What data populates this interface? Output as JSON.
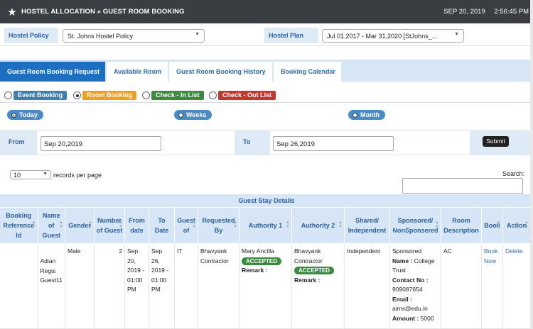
{
  "titlebar": {
    "title": "HOSTEL ALLOCATION » GUEST ROOM BOOKING",
    "date": "SEP 20, 2019",
    "time": "2:56:45 PM",
    "icon": "star-icon"
  },
  "policy": {
    "policy_label": "Hostel Policy",
    "policy_value": "St. Johns Hostel Policy",
    "plan_label": "Hostel Plan",
    "plan_value": "Jul 01,2017 - Mar 31,2020 [StJohns_..."
  },
  "tabs": [
    "Guest Room Booking Request",
    "Available Room",
    "Guest Room Booking History",
    "Booking Calendar"
  ],
  "booking_types": {
    "event": "Event Booking",
    "room": "Room Booking",
    "checkin": "Check - In List",
    "checkout": "Check - Out List"
  },
  "periods": {
    "today": "Today",
    "weeks": "Weeks",
    "month": "Month"
  },
  "range": {
    "from_label": "From",
    "from_value": "Sep 20,2019",
    "to_label": "To",
    "to_value": "Sep 26,2019",
    "submit": "Submit"
  },
  "table_controls": {
    "length": "10",
    "records_label": "records per page",
    "search_label": "Search:"
  },
  "table": {
    "caption": "Guest Stay Details",
    "headers": [
      "Booking Reference Id",
      "Name of Guest",
      "Gender",
      "Number of Guest",
      "From date",
      "To Date",
      "Guest of",
      "Requested By",
      "Authority 1",
      "Authority 2",
      "Shared/ Independent",
      "Sponsored/ NonSponsered",
      "Room Description",
      "Book",
      "Action"
    ],
    "row": {
      "ref": "",
      "name": "Adian Regis Guest11",
      "gender": "Male",
      "count": "2",
      "from": "Sep 20, 2019 - 01:00 PM",
      "to": "Sep 26, 2019 - 01:00 PM",
      "guest_of": "IT",
      "requested_by": "Bhavyank Contractor",
      "auth1_name": "Mary Ancilla",
      "auth1_status": "ACCEPTED",
      "auth1_remark": "Remark :",
      "auth2_name": "Bhavyank Contractor",
      "auth2_status": "ACCEPTED",
      "auth2_remark": "Remark :",
      "shared": "Independent",
      "sponsored": "Sponsored",
      "sp_name_label": "Name :",
      "sp_name": "College Trust",
      "sp_contact_label": "Contact No :",
      "sp_contact": "909087654",
      "sp_email_label": "Email :",
      "sp_email": "aims@edu.in",
      "sp_amount_label": "Amount :",
      "sp_amount": "5000",
      "room": "AC",
      "book": "Book Now",
      "action": "Delete"
    }
  },
  "colors": {
    "titlebar": "#3a3d42",
    "accent": "#1d6fc2",
    "event": "#3b7fb3",
    "room": "#f0a01e",
    "checkin": "#3a8a3f",
    "checkout": "#c0392b",
    "accepted": "#3a8a3f"
  }
}
